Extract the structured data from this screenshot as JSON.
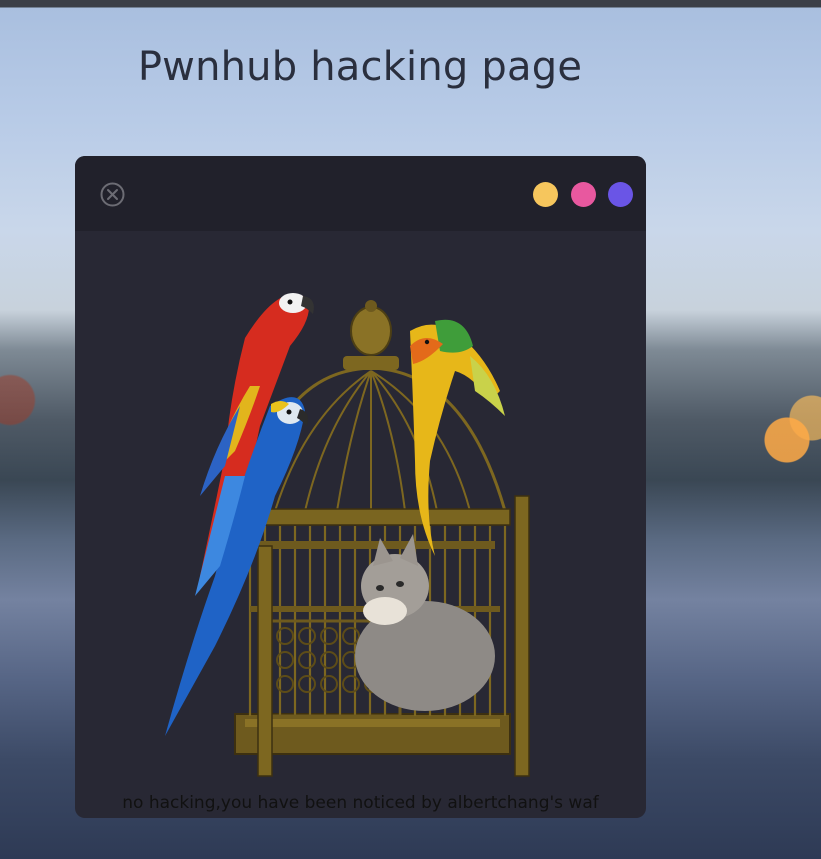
{
  "page": {
    "title": "Pwnhub hacking page"
  },
  "window": {
    "controls": {
      "close_icon": "close-circle-icon",
      "dot_colors": [
        "#f6c65d",
        "#e8589f",
        "#6a55e6"
      ]
    },
    "notice": "no hacking,you have been noticed by albertchang's waf"
  },
  "illustration": {
    "subject": "parrots-on-birdcage-with-cat"
  },
  "colors": {
    "window_bg": "#282834",
    "window_header_bg": "#21212b",
    "title_text": "#2a2f3e"
  }
}
